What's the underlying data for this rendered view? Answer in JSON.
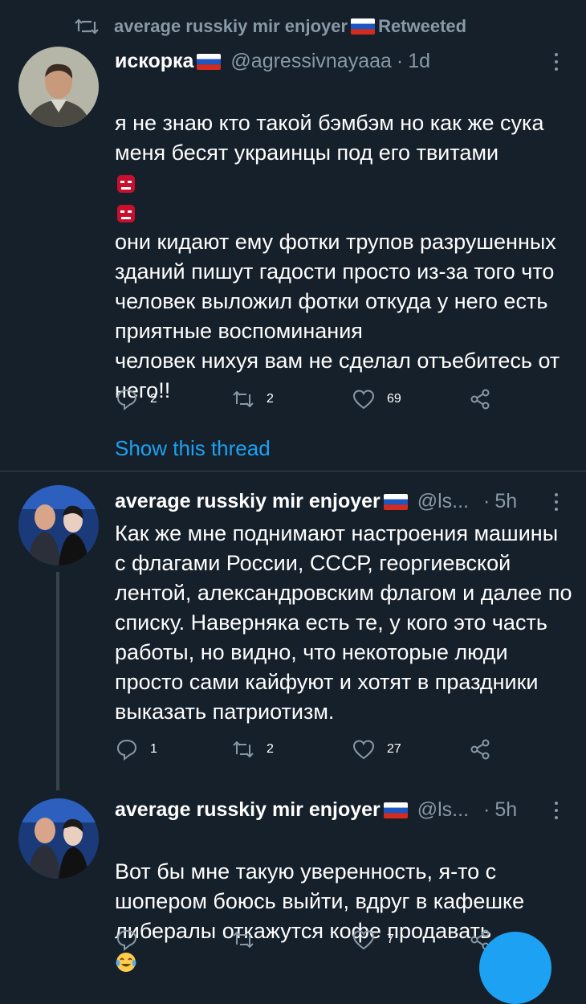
{
  "retweet_banner": {
    "name": "average russkiy mir enjoyer",
    "suffix": "Retweeted"
  },
  "tweet1": {
    "name": "искорка",
    "handle": "@agressivnayaaa",
    "time": "1d",
    "text_line1": "я не знаю кто такой бэмбэм но как же сука меня бесят украинцы под его твитами",
    "text_rest": "они кидают ему фотки трупов разрушенных зданий пишут гадости просто из-за того что человек выложил фотки откуда у него есть приятные воспоминания\nчеловек нихуя вам не сделал отъебитесь от него!!",
    "replies": "2",
    "retweets": "2",
    "likes": "69",
    "show_thread": "Show this thread"
  },
  "tweet2": {
    "name": "average russkiy mir enjoyer",
    "handle": "@ls...",
    "time": "5h",
    "text": "Как же мне поднимают настроения машины с флагами России, СССР, георгиевской лентой, александровским флагом и далее по списку. Наверняка есть те, у кого это часть работы,  но видно, что некоторые люди просто сами кайфуют и хотят в праздники выказать патриотизм.",
    "replies": "1",
    "retweets": "2",
    "likes": "27"
  },
  "tweet3": {
    "name": "average russkiy mir enjoyer",
    "handle": "@ls...",
    "time": "5h",
    "text": "Вот бы мне такую уверенность, я-то с шопером боюсь выйти, вдруг в кафешке либералы откажутся кофе продавать",
    "replies": "",
    "retweets": "",
    "likes": "7"
  },
  "icons": {
    "reply": "reply-icon",
    "retweet": "retweet-icon",
    "like": "heart-icon",
    "share": "share-icon",
    "more": "more-vertical-icon",
    "flag": "russian-flag-icon",
    "angry": "goblin-emoji-icon",
    "laugh": "tears-of-joy-emoji-icon"
  },
  "colors": {
    "background": "#15202b",
    "muted": "#8899a6",
    "accent": "#1da1f2",
    "divider": "#38444d"
  }
}
